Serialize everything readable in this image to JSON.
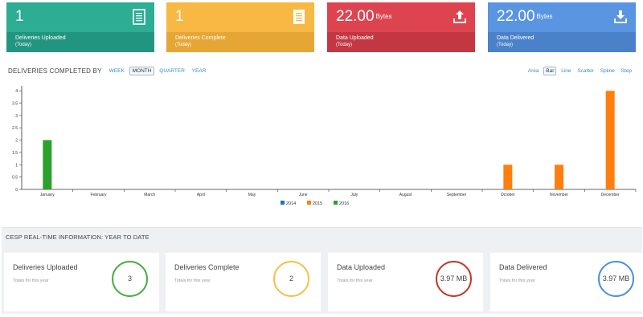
{
  "tiles": [
    {
      "value": "1",
      "unit": "",
      "label": "Deliveries Uploaded",
      "sub": "(Today)",
      "icon": "document-icon",
      "top_color": "#2cad94",
      "bottom_color": "#229580"
    },
    {
      "value": "1",
      "unit": "",
      "label": "Deliveries Complete",
      "sub": "(Today)",
      "icon": "document-icon",
      "top_color": "#f7b944",
      "bottom_color": "#e6a635"
    },
    {
      "value": "22.00",
      "unit": "Bytes",
      "label": "Data Uploaded",
      "sub": "(Today)",
      "icon": "upload-icon",
      "top_color": "#de4450",
      "bottom_color": "#c33742"
    },
    {
      "value": "22.00",
      "unit": "Bytes",
      "label": "Data Delivered",
      "sub": "(Today)",
      "icon": "download-icon",
      "top_color": "#5a95e2",
      "bottom_color": "#4a81c8"
    }
  ],
  "chart_header": {
    "title": "DELIVERIES COMPLETED BY",
    "periods": [
      "WEEK",
      "MONTH",
      "QUARTER",
      "YEAR"
    ],
    "active_period": "MONTH",
    "types": [
      "Area",
      "Bar",
      "Line",
      "Scatter",
      "Spline",
      "Step"
    ],
    "active_type": "Bar"
  },
  "chart_data": {
    "type": "bar",
    "categories": [
      "January",
      "February",
      "March",
      "April",
      "May",
      "June",
      "July",
      "August",
      "September",
      "October",
      "November",
      "December"
    ],
    "series": [
      {
        "name": "2014",
        "color": "#1f77b4",
        "values": [
          0,
          0,
          0,
          0,
          0,
          0,
          0,
          0,
          0,
          0,
          0,
          0
        ]
      },
      {
        "name": "2015",
        "color": "#ff7f0e",
        "values": [
          0,
          0,
          0,
          0,
          0,
          0,
          0,
          0,
          0,
          1,
          1,
          4
        ]
      },
      {
        "name": "2016",
        "color": "#2ca02c",
        "values": [
          2,
          0,
          0,
          0,
          0,
          0,
          0,
          0,
          0,
          0,
          0,
          0
        ]
      }
    ],
    "yticks": [
      "0",
      "0.5",
      "1",
      "1.5",
      "2",
      "2.5",
      "3",
      "3.5",
      "4"
    ],
    "ylim": [
      0,
      4.2
    ],
    "legend_position": "bottom-center",
    "grid": false
  },
  "realtime": {
    "title": "CESP REAL-TIME INFORMATION: YEAR TO DATE",
    "cards": [
      {
        "label": "Deliveries Uploaded",
        "sub": "Totals for this year",
        "value": "3",
        "color": "#46b03e"
      },
      {
        "label": "Deliveries Complete",
        "sub": "Totals for this year",
        "value": "2",
        "color": "#f0c24a"
      },
      {
        "label": "Data Uploaded",
        "sub": "Totals for this year",
        "value": "3.97 MB",
        "color": "#c0392b"
      },
      {
        "label": "Data Delivered",
        "sub": "Totals for this year",
        "value": "3.97 MB",
        "color": "#4a8fe0"
      }
    ]
  }
}
